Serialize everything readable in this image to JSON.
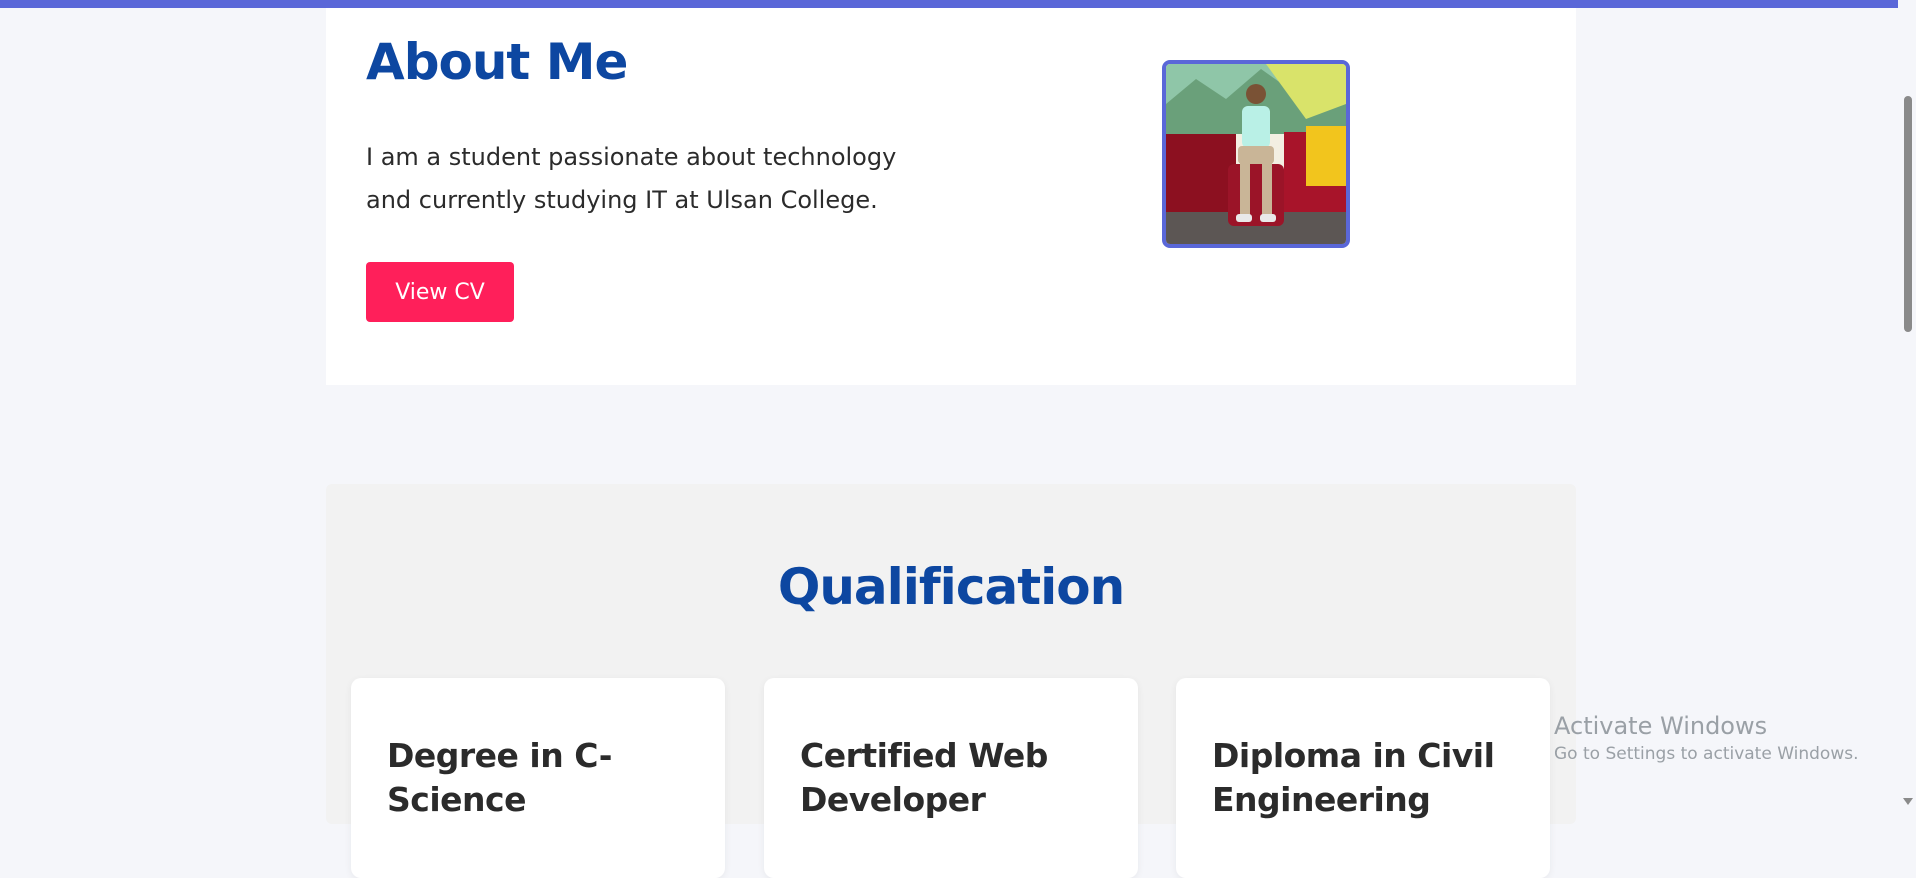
{
  "colors": {
    "accent": "#5a67d8",
    "heading": "#0d47a1",
    "button": "#ff1f5a",
    "page_background": "#f5f6fa"
  },
  "about": {
    "title": "About Me",
    "description": "I am a student passionate about technology and currently studying IT at Ulsan College.",
    "cv_button_label": "View CV",
    "photo_icon": "profile-photo"
  },
  "qualification": {
    "title": "Qualification",
    "cards": [
      {
        "title": "Degree in C-Science"
      },
      {
        "title": "Certified Web Developer"
      },
      {
        "title": "Diploma in Civil Engineering"
      }
    ]
  },
  "watermark": {
    "line1": "Activate Windows",
    "line2": "Go to Settings to activate Windows."
  }
}
